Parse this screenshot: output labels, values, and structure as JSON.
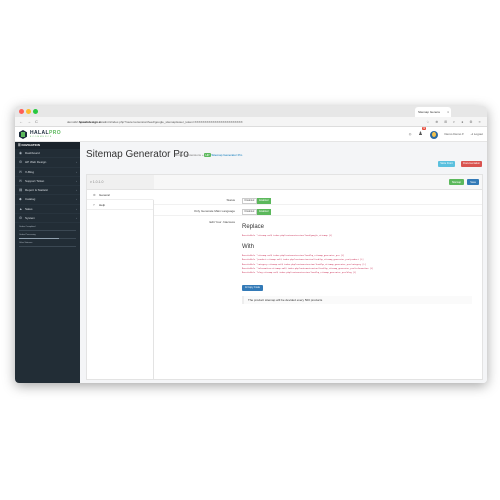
{
  "browser": {
    "tab_title": "Sitemap Genera",
    "tab_close": "×",
    "url_prefix": "demo02.",
    "url_domain": "hpwebdesign.io",
    "url_path": "/admin/index.php?route=extension/feed/google_sitemap&user_token=XXXXXXXXXXXXXXXXXXXXXXXX",
    "nav_back": "←",
    "nav_forward": "→",
    "nav_reload": "C",
    "toolbar_icons": "☆ ⊕ ⊞ ◐ ● ⚙ ≡"
  },
  "app": {
    "logo_brand_main": "HALAL",
    "logo_brand_accent": "PRO",
    "logo_sub": "ECOMMERCE",
    "notifications_count": "9",
    "user_name": "Demo Demo ▾",
    "logout": "⇥ Logout"
  },
  "sidebar": {
    "header": "☰ NAVIGATION",
    "items": [
      {
        "icon": "◉",
        "label": "Dashboard",
        "arrow": ""
      },
      {
        "icon": "⚙",
        "label": "HP Web Design",
        "arrow": "›"
      },
      {
        "icon": "✉",
        "label": "X-Blog",
        "arrow": "›"
      },
      {
        "icon": "✉",
        "label": "Support Ticket",
        "arrow": "›"
      },
      {
        "icon": "▤",
        "label": "Report & Statistic",
        "arrow": "›"
      },
      {
        "icon": "◆",
        "label": "Catalog",
        "arrow": "›"
      },
      {
        "icon": "▲",
        "label": "Sales",
        "arrow": "›"
      },
      {
        "icon": "⚙",
        "label": "System",
        "arrow": "›"
      }
    ],
    "stats": [
      {
        "label": "Orders Completed",
        "fill": 0.0
      },
      {
        "label": "Orders Processing",
        "fill": 0.7
      },
      {
        "label": "Other Statuses",
        "fill": 0.0
      }
    ]
  },
  "header": {
    "title": "Sitemap Generator Pro",
    "breadcrumb": [
      "Home",
      "Extensions",
      "HP",
      "Sitemap Generator Pro"
    ],
    "btn_store": "Store Front",
    "btn_doc": "Documentation"
  },
  "panel": {
    "version": "v 1.0.1.0",
    "btn_sitemap": "Sitemap",
    "btn_save": "Save",
    "tabs": [
      {
        "icon": "⚙",
        "label": "General"
      },
      {
        "icon": "?",
        "label": "Help"
      }
    ],
    "status_label": "Status",
    "status_off": "Disabled",
    "status_on": "Enabled",
    "lang_label": "Only Generate Main Language",
    "lang_off": "Disabled",
    "lang_on": "Enabled",
    "edit_label": "Edit Your .htaccess",
    "replace_heading": "Replace",
    "replace_code": "RewriteRule ^sitemap.xml$ index.php?route=extension/feed/google_sitemap [L]",
    "with_heading": "With",
    "with_code": [
      "RewriteRule ^sitemap.xml$ index.php?route=extension/feed/hp_sitemap_generator_pro [L]",
      "RewriteRule ^product-sitemap.xml$ index.php?route=extension/feed/hp_sitemap_generator_pro/product [L]",
      "RewriteRule ^category-sitemap.xml$ index.php?route=extension/feed/hp_sitemap_generator_pro/category [L]",
      "RewriteRule ^information-sitemap.xml$ index.php?route=extension/feed/hp_sitemap_generator_pro/information [L]",
      "RewriteRule ^blog-sitemap.xml$ index.php?route=extension/feed/hp_sitemap_generator_pro/blog [L]"
    ],
    "copy_btn": "Copy Code",
    "note": "The product sitemap will be devided every 500 products"
  }
}
